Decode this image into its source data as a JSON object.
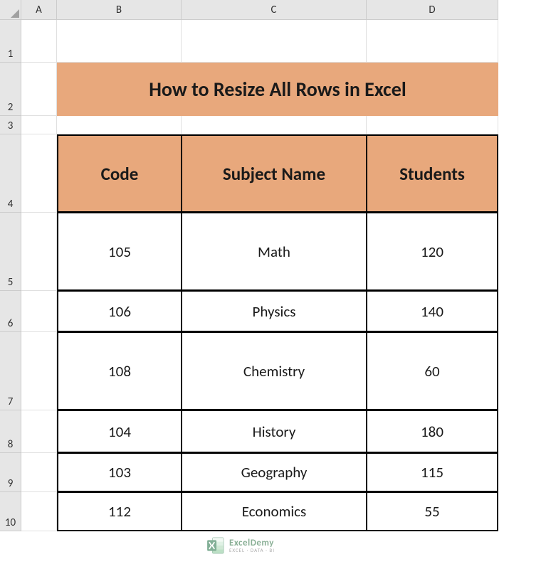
{
  "columns": [
    "A",
    "B",
    "C",
    "D"
  ],
  "rows": [
    "1",
    "2",
    "3",
    "4",
    "5",
    "6",
    "7",
    "8",
    "9",
    "10"
  ],
  "title": "How to Resize All Rows in Excel",
  "headers": {
    "code": "Code",
    "subject": "Subject Name",
    "students": "Students"
  },
  "data": [
    {
      "code": "105",
      "subject": "Math",
      "students": "120"
    },
    {
      "code": "106",
      "subject": "Physics",
      "students": "140"
    },
    {
      "code": "108",
      "subject": "Chemistry",
      "students": "60"
    },
    {
      "code": "104",
      "subject": "History",
      "students": "180"
    },
    {
      "code": "103",
      "subject": "Geography",
      "students": "115"
    },
    {
      "code": "112",
      "subject": "Economics",
      "students": "55"
    }
  ],
  "watermark": {
    "name": "ExcelDemy",
    "tagline": "EXCEL · DATA · BI"
  }
}
